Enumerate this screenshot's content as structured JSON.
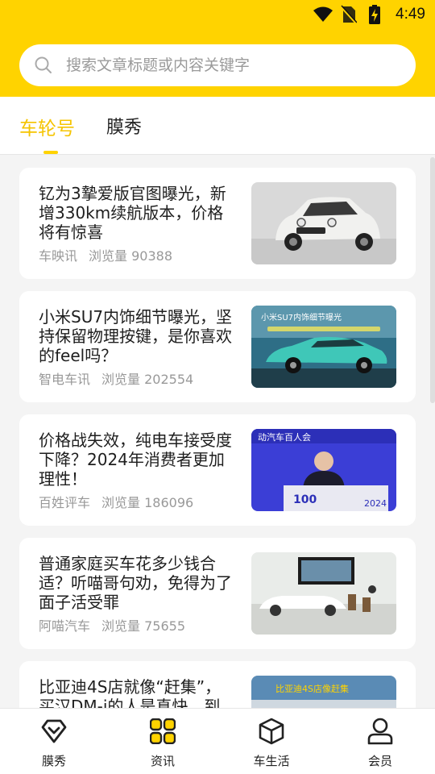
{
  "status_bar": {
    "time": "4:49",
    "icons": [
      "wifi-icon",
      "no-sim-icon",
      "battery-icon"
    ]
  },
  "search": {
    "placeholder": "搜索文章标题或内容关键字"
  },
  "tabs": [
    {
      "label": "车轮号",
      "active": true
    },
    {
      "label": "膜秀",
      "active": false
    }
  ],
  "articles": [
    {
      "title": "钇为3摯爱版官图曝光，新增330km续航版本，价格将有惊喜",
      "source": "车映讯",
      "views": "浏览量 90388",
      "thumb_icon": "white-hatchback-photo"
    },
    {
      "title": "小米SU7内饰细节曝光，坚持保留物理按键，是你喜欢的feel吗？",
      "source": "智电车讯",
      "views": "浏览量 202554",
      "thumb_icon": "teal-sedan-photo",
      "thumb_text": "小米SU7内饰细节曝光"
    },
    {
      "title": "价格战失效，纯电车接受度下降？2024年消费者更加理性！",
      "source": "百姓评车",
      "views": "浏览量 186096",
      "thumb_icon": "speaker-podium-photo",
      "thumb_text": "动汽车百人会",
      "thumb_year": "2024",
      "thumb_logo": "100"
    },
    {
      "title": "普通家庭买车花多少钱合适？听喵哥句劝，免得为了面子活受罪",
      "source": "阿喵汽车",
      "views": "浏览量 75655",
      "thumb_icon": "showroom-photo"
    },
    {
      "title": "比亚迪4S店就像“赶集”，买汉DM-i的人是真快，到",
      "source": "",
      "views": "",
      "thumb_icon": "crowded-dealership-photo",
      "thumb_text": "比亚迪4S店像赶集"
    }
  ],
  "bottom_nav": [
    {
      "label": "膜秀",
      "icon": "heart-diamond-icon"
    },
    {
      "label": "资讯",
      "icon": "grid-icon"
    },
    {
      "label": "车生活",
      "icon": "cube-icon"
    },
    {
      "label": "会员",
      "icon": "user-icon"
    }
  ],
  "colors": {
    "brand_yellow": "#ffd300",
    "active_tab": "#f5c400",
    "meta_gray": "#999999",
    "background": "#f4f4f4"
  }
}
